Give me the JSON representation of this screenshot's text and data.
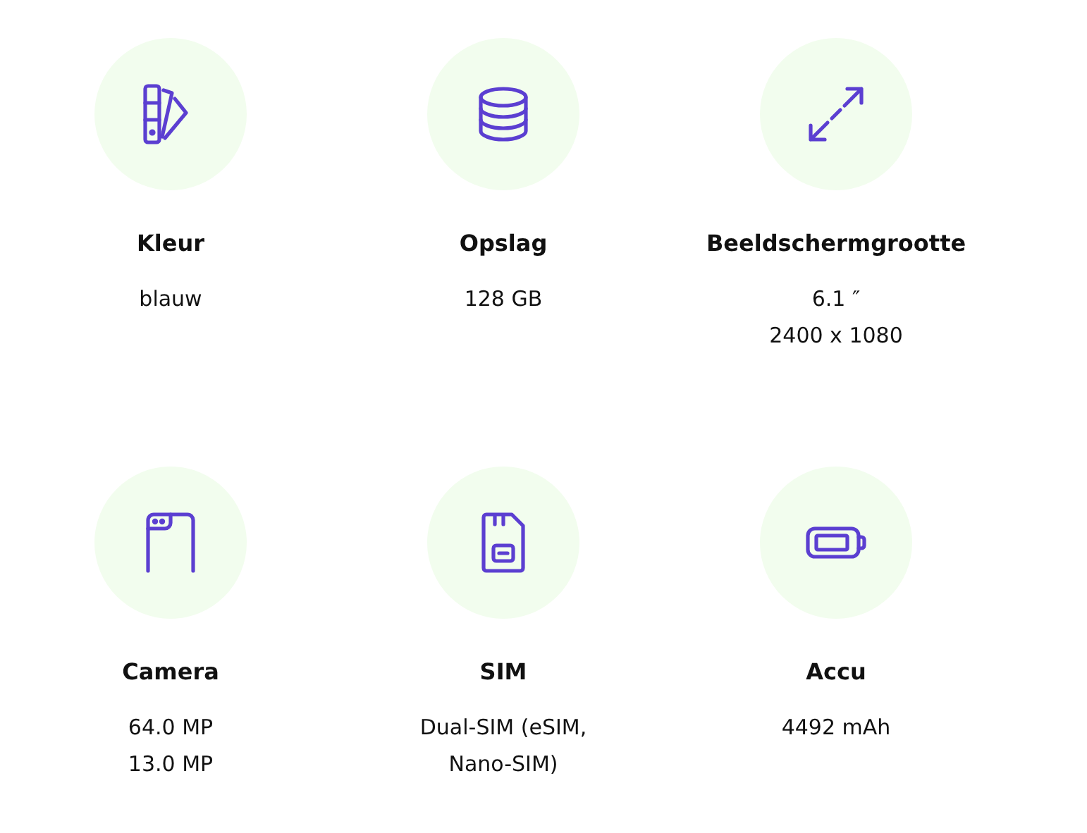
{
  "specs": [
    {
      "kind": "palette",
      "title": "Kleur",
      "values": [
        "blauw"
      ]
    },
    {
      "kind": "storage",
      "title": "Opslag",
      "values": [
        "128 GB"
      ]
    },
    {
      "kind": "screen",
      "title": "Beeldschermgrootte",
      "values": [
        "6.1 ″",
        "2400 x 1080"
      ]
    },
    {
      "kind": "camera",
      "title": "Camera",
      "values": [
        "64.0 MP",
        "13.0 MP"
      ]
    },
    {
      "kind": "sim",
      "title": "SIM",
      "values": [
        "Dual-SIM (eSIM,",
        "Nano-SIM)"
      ]
    },
    {
      "kind": "battery",
      "title": "Accu",
      "values": [
        "4492 mAh"
      ]
    }
  ]
}
